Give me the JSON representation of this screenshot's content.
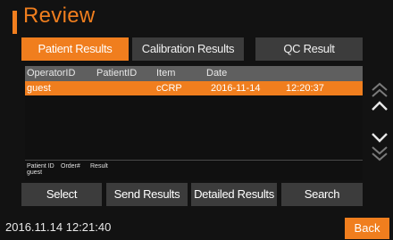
{
  "header": {
    "title": "Review"
  },
  "tabs": [
    {
      "label": "Patient Results",
      "active": true
    },
    {
      "label": "Calibration Results",
      "active": false
    },
    {
      "label": "QC Result",
      "active": false
    }
  ],
  "table": {
    "columns": [
      "OperatorID",
      "PatientID",
      "Item",
      "Date"
    ],
    "rows": [
      {
        "operator": "guest",
        "patient": "",
        "item": "cCRP",
        "date": "2016-11-14",
        "time": "12:20:37",
        "selected": true
      }
    ]
  },
  "detail": {
    "headers": [
      "Patient ID",
      "Order#",
      "Result"
    ],
    "values": [
      "guest"
    ]
  },
  "actions": [
    "Select",
    "Send Results",
    "Detailed Results",
    "Search"
  ],
  "scroll_icons": [
    "double-up-arrow",
    "up-arrow",
    "down-arrow",
    "double-down-arrow"
  ],
  "footer": {
    "datetime": "2016.11.14  12:21:40",
    "back_label": "Back"
  },
  "colors": {
    "accent": "#f07e1e",
    "background": "#121212",
    "button": "#3c3c3c",
    "table_header": "#5f5f5f"
  }
}
